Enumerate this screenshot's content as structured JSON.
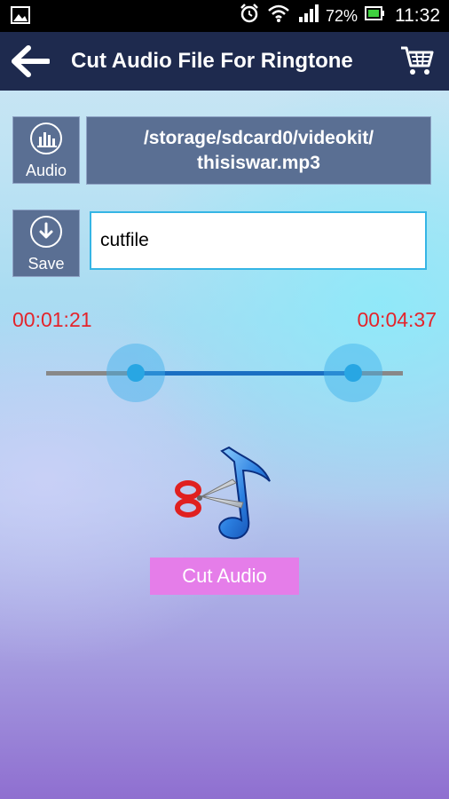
{
  "status_bar": {
    "battery": "72%",
    "time": "11:32"
  },
  "header": {
    "title": "Cut Audio File For Ringtone"
  },
  "audio": {
    "label": "Audio",
    "file_path": "/storage/sdcard0/videokit/\nthisiswar.mp3"
  },
  "save": {
    "label": "Save",
    "file_name": "cutfile"
  },
  "range": {
    "start_time": "00:01:21",
    "end_time": "00:04:37",
    "start_fraction": 0.25,
    "end_fraction": 0.86
  },
  "actions": {
    "cut_label": "Cut Audio"
  },
  "colors": {
    "accent_red": "#e4242b",
    "button_pink": "#e57de9",
    "header_bg": "#1e2a4e",
    "tile_bg": "#5a6f93"
  }
}
